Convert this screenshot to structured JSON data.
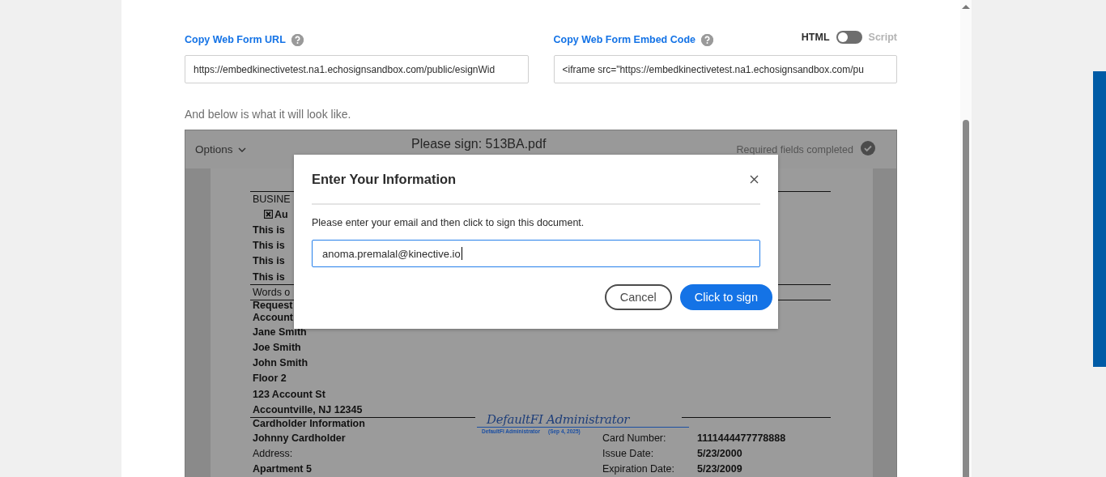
{
  "url_field": {
    "label": "Copy Web Form URL",
    "value": "https://embedkinectivetest.na1.echosignsandbox.com/public/esignWid"
  },
  "embed_field": {
    "label": "Copy Web Form Embed Code",
    "value": "<iframe src=\"https://embedkinectivetest.na1.echosignsandbox.com/pu"
  },
  "format_toggle": {
    "left_label": "HTML",
    "right_label": "Script",
    "on": false
  },
  "preview_caption": "And below is what it will look like.",
  "preview": {
    "options_menu": "Options",
    "title": "Please sign: 513BA.pdf",
    "status": "Required fields completed",
    "completed": true,
    "document": [
      {
        "kind": "rule"
      },
      {
        "kind": "text",
        "text": "BUSINE",
        "bold": false
      },
      {
        "kind": "check",
        "text": "Au",
        "checked": true
      },
      {
        "kind": "text",
        "text": "This is",
        "bold": true
      },
      {
        "kind": "text",
        "text": "This is",
        "bold": true
      },
      {
        "kind": "text",
        "text": "This is",
        "bold": true
      },
      {
        "kind": "text",
        "text": "This is",
        "bold": true
      },
      {
        "kind": "rule"
      },
      {
        "kind": "text",
        "text": "Words o",
        "bold": false
      },
      {
        "kind": "rule"
      },
      {
        "kind": "tight",
        "text": "Request",
        "bold": true
      },
      {
        "kind": "tight",
        "text": "Account",
        "bold": true
      },
      {
        "kind": "text",
        "text": "Jane Smith",
        "bold": true
      },
      {
        "kind": "text",
        "text": "Joe Smith",
        "bold": true
      },
      {
        "kind": "text",
        "text": "John Smith",
        "bold": true
      },
      {
        "kind": "text",
        "text": "Floor 2",
        "bold": true
      },
      {
        "kind": "text",
        "text": "123 Account St",
        "bold": true
      },
      {
        "kind": "text",
        "text": "Accountville, NJ 12345",
        "bold": true
      },
      {
        "kind": "split_rule"
      },
      {
        "kind": "tight",
        "text": "Cardholder Information",
        "bold": true
      },
      {
        "kind": "pair",
        "text": "Johnny Cardholder",
        "bold": true,
        "label": "Card Number:",
        "value": "1111444477778888"
      },
      {
        "kind": "pair",
        "text": "Address:",
        "bold": false,
        "label": "Issue Date:",
        "value": "5/23/2000"
      },
      {
        "kind": "pair",
        "text": "Apartment 5",
        "bold": true,
        "label": "Expiration Date:",
        "value": "5/23/2009"
      }
    ],
    "signature": {
      "script": "DefaultFI Administrator",
      "caption": "DefaultFI Administrator",
      "date": "(Sep 4, 2025)"
    }
  },
  "dialog": {
    "title": "Enter Your Information",
    "message": "Please enter your email and then click to sign this document.",
    "email": "anoma.premalal@kinective.io",
    "cancel": "Cancel",
    "confirm": "Click to sign"
  }
}
